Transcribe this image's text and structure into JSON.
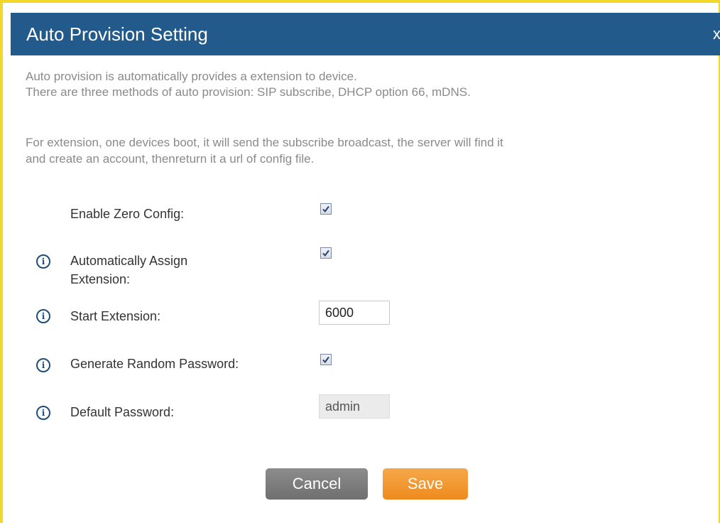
{
  "dialog": {
    "title": "Auto Provision Setting",
    "close_label": "x"
  },
  "description": {
    "line1": "Auto provision is automatically provides a extension to device.",
    "line2": "There are three methods of auto provision: SIP subscribe, DHCP option 66, mDNS.",
    "line3": "For extension, one devices boot, it will send the subscribe broadcast, the server will find it",
    "line4": "and create an account, thenreturn it a url of config file."
  },
  "form": {
    "enable_zero_config": {
      "label": "Enable Zero Config:",
      "checked": true
    },
    "auto_assign_extension": {
      "label_line1": "Automatically Assign",
      "label_line2": "Extension:",
      "checked": true,
      "info_icon": "info-icon"
    },
    "start_extension": {
      "label": "Start Extension:",
      "value": "6000",
      "info_icon": "info-icon"
    },
    "generate_random_password": {
      "label": "Generate Random Password:",
      "checked": true,
      "info_icon": "info-icon"
    },
    "default_password": {
      "label": "Default Password:",
      "value": "admin",
      "disabled": true,
      "info_icon": "info-icon"
    }
  },
  "buttons": {
    "cancel_label": "Cancel",
    "save_label": "Save"
  },
  "colors": {
    "title_bar": "#215a8b",
    "frame_border": "#f2d62a",
    "save_button": "#ee8a1e",
    "cancel_button": "#7a7a7a",
    "info_icon": "#1f4e79"
  }
}
